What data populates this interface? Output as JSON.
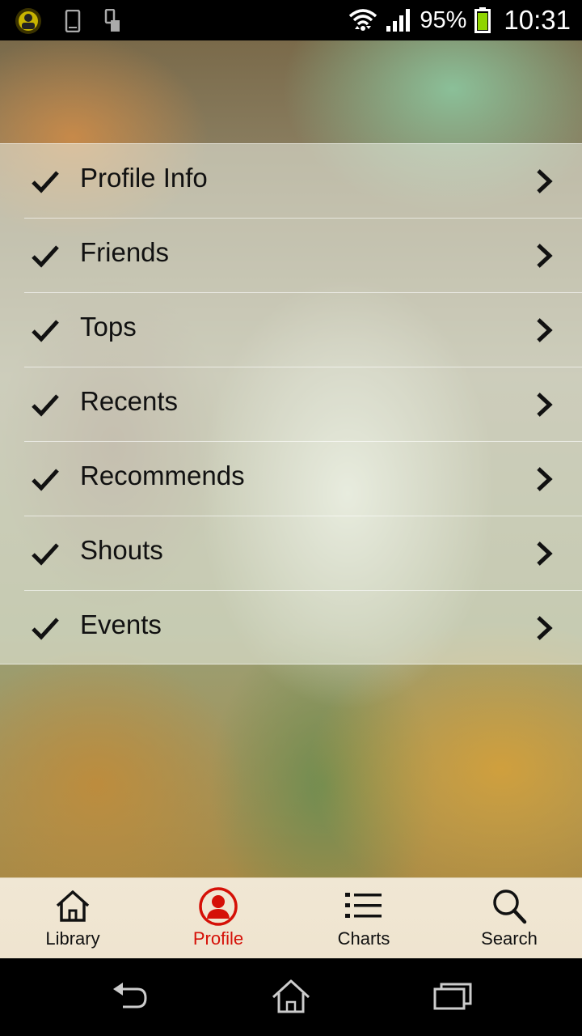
{
  "status_bar": {
    "battery": "95%",
    "time": "10:31"
  },
  "menu": {
    "items": [
      {
        "label": "Profile Info"
      },
      {
        "label": "Friends"
      },
      {
        "label": "Tops"
      },
      {
        "label": "Recents"
      },
      {
        "label": "Recommends"
      },
      {
        "label": "Shouts"
      },
      {
        "label": "Events"
      }
    ]
  },
  "bottom_nav": {
    "items": [
      {
        "label": "Library",
        "icon": "home-icon"
      },
      {
        "label": "Profile",
        "icon": "profile-icon",
        "active": true
      },
      {
        "label": "Charts",
        "icon": "list-icon"
      },
      {
        "label": "Search",
        "icon": "search-icon"
      }
    ],
    "active_color": "#d51007"
  }
}
